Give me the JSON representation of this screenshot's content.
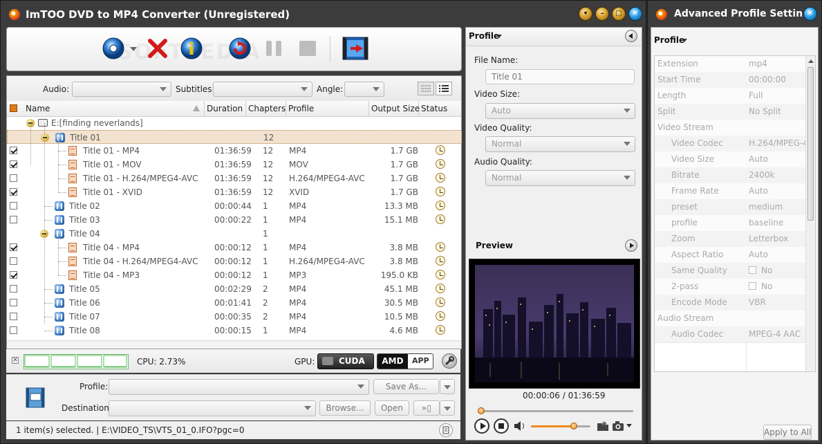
{
  "main_window": {
    "title": "ImTOO DVD to MP4 Converter (Unregistered)"
  },
  "toolbar": {
    "watermark": "SOFTPEDIA"
  },
  "filter_bar": {
    "audio_label": "Audio:",
    "subtitles_label": "Subtitles:",
    "angle_label": "Angle:"
  },
  "table": {
    "headers": {
      "name": "Name",
      "duration": "Duration",
      "chapters": "Chapters",
      "profile": "Profile",
      "output_size": "Output Size",
      "status": "Status"
    },
    "rows": [
      {
        "type": "source",
        "name": "E:[finding neverlands]"
      },
      {
        "type": "title",
        "name": "Title 01",
        "chapters": "12",
        "level": 1,
        "selected": true
      },
      {
        "type": "file",
        "name": "Title 01 - MP4",
        "duration": "01:36:59",
        "chapters": "12",
        "profile": "MP4",
        "size": "1.7 GB",
        "checked": true
      },
      {
        "type": "file",
        "name": "Title 01 - MOV",
        "duration": "01:36:59",
        "chapters": "12",
        "profile": "MOV",
        "size": "1.7 GB",
        "checked": true
      },
      {
        "type": "file",
        "name": "Title 01 - H.264/MPEG4-AVC",
        "duration": "01:36:59",
        "chapters": "12",
        "profile": "H.264/MPEG4-AVC",
        "size": "1.7 GB",
        "checked": false
      },
      {
        "type": "file",
        "name": "Title 01 - XVID",
        "duration": "01:36:59",
        "chapters": "12",
        "profile": "XVID",
        "size": "1.7 GB",
        "checked": true
      },
      {
        "type": "title",
        "name": "Title 02",
        "duration": "00:00:44",
        "chapters": "1",
        "profile": "MP4",
        "size": "13.3 MB",
        "checked": false
      },
      {
        "type": "title",
        "name": "Title 03",
        "duration": "00:00:22",
        "chapters": "1",
        "profile": "MP4",
        "size": "15.1 MB",
        "checked": false
      },
      {
        "type": "title",
        "name": "Title 04",
        "chapters": "1",
        "level": 1
      },
      {
        "type": "file",
        "name": "Title 04 - MP4",
        "duration": "00:00:12",
        "chapters": "1",
        "profile": "MP4",
        "size": "3.8 MB",
        "checked": true
      },
      {
        "type": "file",
        "name": "Title 04 - H.264/MPEG4-AVC",
        "duration": "00:00:12",
        "chapters": "1",
        "profile": "H.264/MPEG4-AVC",
        "size": "3.8 MB",
        "checked": false
      },
      {
        "type": "file",
        "name": "Title 04 - MP3",
        "duration": "00:00:12",
        "chapters": "1",
        "profile": "MP3",
        "size": "195.0 KB",
        "checked": true
      },
      {
        "type": "title",
        "name": "Title 05",
        "duration": "00:02:29",
        "chapters": "2",
        "profile": "MP4",
        "size": "45.1 MB",
        "checked": false
      },
      {
        "type": "title",
        "name": "Title 06",
        "duration": "00:01:41",
        "chapters": "2",
        "profile": "MP4",
        "size": "30.5 MB",
        "checked": false
      },
      {
        "type": "title",
        "name": "Title 07",
        "duration": "00:00:35",
        "chapters": "2",
        "profile": "MP4",
        "size": "10.5 MB",
        "checked": false
      },
      {
        "type": "title",
        "name": "Title 08",
        "duration": "00:00:15",
        "chapters": "1",
        "profile": "MP4",
        "size": "4.6 MB",
        "checked": false
      }
    ]
  },
  "cpu_bar": {
    "cpu_text": "CPU: 2.73%",
    "gpu_label": "GPU:",
    "cuda_label": "CUDA",
    "amd_label": "AMD",
    "app_label": "APP"
  },
  "output": {
    "profile_label": "Profile:",
    "destination_label": "Destination:",
    "save_as": "Save As...",
    "browse": "Browse...",
    "open": "Open"
  },
  "status_bar": {
    "text": "1 item(s) selected. | E:\\VIDEO_TS\\VTS_01_0.IFO?pgc=0"
  },
  "profile_panel": {
    "header": "Profile",
    "file_name_label": "File Name:",
    "file_name_value": "Title 01",
    "video_size_label": "Video Size:",
    "video_size_value": "Auto",
    "video_quality_label": "Video Quality:",
    "video_quality_value": "Normal",
    "audio_quality_label": "Audio Quality:",
    "audio_quality_value": "Normal"
  },
  "preview": {
    "header": "Preview",
    "time": "00:00:06 / 01:36:59",
    "progress": 0.02,
    "volume": 0.72
  },
  "advanced": {
    "title": "Advanced Profile Settin...",
    "profile_header": "Profile",
    "apply_all": "Apply to All",
    "rows": [
      {
        "k": "Extension",
        "v": "mp4",
        "indent": 0
      },
      {
        "k": "Start Time",
        "v": "00:00:00",
        "indent": 0
      },
      {
        "k": "Length",
        "v": "Full",
        "indent": 0
      },
      {
        "k": "Split",
        "v": "No Split",
        "indent": 0
      },
      {
        "k": "Video Stream",
        "v": "",
        "indent": 0
      },
      {
        "k": "Video Codec",
        "v": "H.264/MPEG-4",
        "indent": 1
      },
      {
        "k": "Video Size",
        "v": "Auto",
        "indent": 1
      },
      {
        "k": "Bitrate",
        "v": "2400k",
        "indent": 1
      },
      {
        "k": "Frame Rate",
        "v": "Auto",
        "indent": 1
      },
      {
        "k": "preset",
        "v": "medium",
        "indent": 1
      },
      {
        "k": "profile",
        "v": "baseline",
        "indent": 1
      },
      {
        "k": "Zoom",
        "v": "Letterbox",
        "indent": 1
      },
      {
        "k": "Aspect Ratio",
        "v": "Auto",
        "indent": 1
      },
      {
        "k": "Same Quality",
        "v": "No",
        "indent": 1,
        "checkbox": true
      },
      {
        "k": "2-pass",
        "v": "No",
        "indent": 1,
        "checkbox": true
      },
      {
        "k": "Encode Mode",
        "v": "VBR",
        "indent": 1
      },
      {
        "k": "Audio Stream",
        "v": "",
        "indent": 0
      },
      {
        "k": "Audio Codec",
        "v": "MPEG-4 AAC",
        "indent": 1
      }
    ]
  }
}
